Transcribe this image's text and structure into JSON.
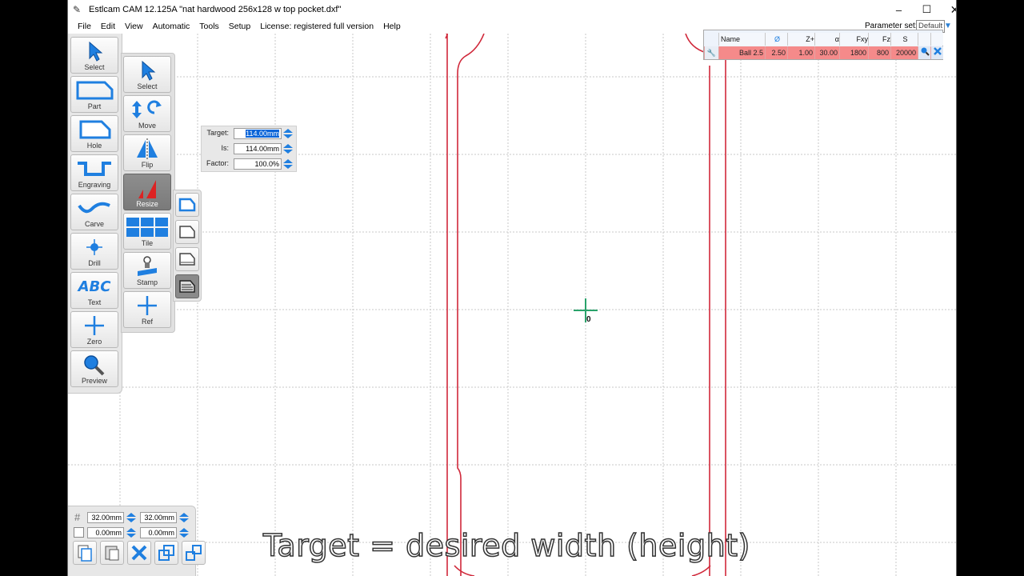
{
  "window": {
    "title": "Estlcam CAM 12.125A \"nat hardwood 256x128 w top pocket.dxf\"",
    "minimize": "–",
    "maximize": "☐",
    "close": "✕"
  },
  "menu": {
    "items": [
      "File",
      "Edit",
      "View",
      "Automatic",
      "Tools",
      "Setup",
      "License: registered full version",
      "Help"
    ],
    "parameter_set_label": "Parameter set:",
    "parameter_set_value": "Default"
  },
  "left_toolbar": {
    "tools": [
      {
        "label": "Select",
        "icon": "cursor-icon"
      },
      {
        "label": "Part",
        "icon": "part-outline-icon"
      },
      {
        "label": "Hole",
        "icon": "hole-outline-icon"
      },
      {
        "label": "Engraving",
        "icon": "engraving-icon"
      },
      {
        "label": "Carve",
        "icon": "carve-icon"
      },
      {
        "label": "Drill",
        "icon": "drill-icon"
      },
      {
        "label": "Text",
        "icon": "text-abc-icon",
        "glyph": "ABC"
      },
      {
        "label": "Zero",
        "icon": "zero-cross-icon"
      },
      {
        "label": "Preview",
        "icon": "magnifier-icon"
      }
    ]
  },
  "sub_toolbar": {
    "tools": [
      {
        "label": "Select",
        "icon": "cursor-icon"
      },
      {
        "label": "Move",
        "icon": "move-rotate-icon"
      },
      {
        "label": "Flip",
        "icon": "flip-icon"
      },
      {
        "label": "Resize",
        "icon": "resize-icon",
        "active": true
      },
      {
        "label": "Tile",
        "icon": "tile-grid-icon"
      },
      {
        "label": "Stamp",
        "icon": "stamp-icon"
      },
      {
        "label": "Ref",
        "icon": "ref-cross-icon"
      }
    ]
  },
  "resize_panel": {
    "target_label": "Target:",
    "target_value": "114.00mm",
    "is_label": "Is:",
    "is_value": "114.00mm",
    "factor_label": "Factor:",
    "factor_value": "100.0%"
  },
  "tool_table": {
    "headers": [
      "Name",
      "Ø",
      "Z+",
      "α",
      "Fxy",
      "Fz",
      "S"
    ],
    "row": [
      "Ball 2.5",
      "2.50",
      "1.00",
      "30.00",
      "1800",
      "800",
      "20000"
    ]
  },
  "bottom_panel": {
    "grid_x": "32.00mm",
    "grid_y": "32.00mm",
    "offset_x": "0.00mm",
    "offset_y": "0.00mm"
  },
  "canvas": {
    "origin_marker": "0"
  },
  "caption": "Target = desired width (height)",
  "colors": {
    "accent": "#1f7fe0",
    "part_outline": "#d0283a",
    "origin": "#2aa36b",
    "tool_row": "#f58a8a"
  }
}
